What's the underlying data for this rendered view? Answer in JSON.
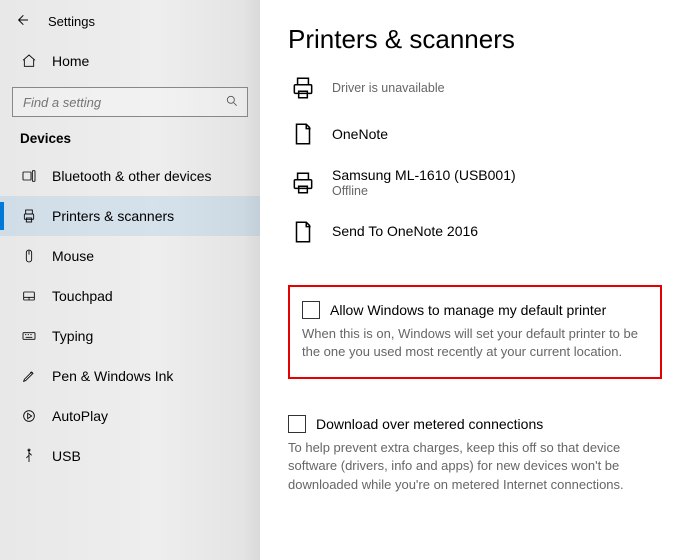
{
  "app": {
    "title": "Settings"
  },
  "home": {
    "label": "Home"
  },
  "search": {
    "placeholder": "Find a setting"
  },
  "group": {
    "heading": "Devices"
  },
  "nav": {
    "items": [
      {
        "label": "Bluetooth & other devices"
      },
      {
        "label": "Printers & scanners"
      },
      {
        "label": "Mouse"
      },
      {
        "label": "Touchpad"
      },
      {
        "label": "Typing"
      },
      {
        "label": "Pen & Windows Ink"
      },
      {
        "label": "AutoPlay"
      },
      {
        "label": "USB"
      }
    ]
  },
  "page": {
    "title": "Printers & scanners"
  },
  "devices": [
    {
      "name": "",
      "status": "Driver is unavailable"
    },
    {
      "name": "OneNote",
      "status": ""
    },
    {
      "name": "Samsung ML-1610 (USB001)",
      "status": "Offline"
    },
    {
      "name": "Send To OneNote 2016",
      "status": ""
    }
  ],
  "option_default": {
    "label": "Allow Windows to manage my default printer",
    "desc": "When this is on, Windows will set your default printer to be the one you used most recently at your current location."
  },
  "option_metered": {
    "label": "Download over metered connections",
    "desc": "To help prevent extra charges, keep this off so that device software (drivers, info and apps) for new devices won't be downloaded while you're on metered Internet connections."
  }
}
